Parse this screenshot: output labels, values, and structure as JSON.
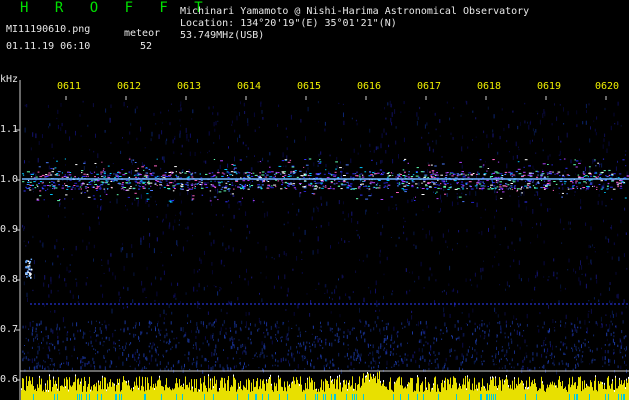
{
  "header": {
    "app_title": "H R O F F T",
    "filename": "MI11190610.png",
    "datetime": "01.11.19 06:10",
    "meteor_label": "meteor",
    "meteor_count": "52",
    "observer": "Michinari Yamamoto @ Nishi-Harima Astronomical Observatory",
    "location": "Location: 134°20'19\"(E) 35°01'21\"(N)",
    "frequency": "53.749MHz(USB)"
  },
  "axes": {
    "y_unit": "kHz",
    "y_ticks": [
      "1.1",
      "1.0",
      "0.9",
      "0.8",
      "0.7",
      "0.6"
    ],
    "time_ticks": [
      "0611",
      "0612",
      "0613",
      "0614",
      "0615",
      "0616",
      "0617",
      "0618",
      "0619",
      "0620"
    ]
  },
  "colors": {
    "background": "#000000",
    "title": "#00e000",
    "text": "#e8e8e8",
    "time_labels": "#f0f000",
    "carrier": "#6fb4ff",
    "noise_floor": "#e8e000"
  }
}
